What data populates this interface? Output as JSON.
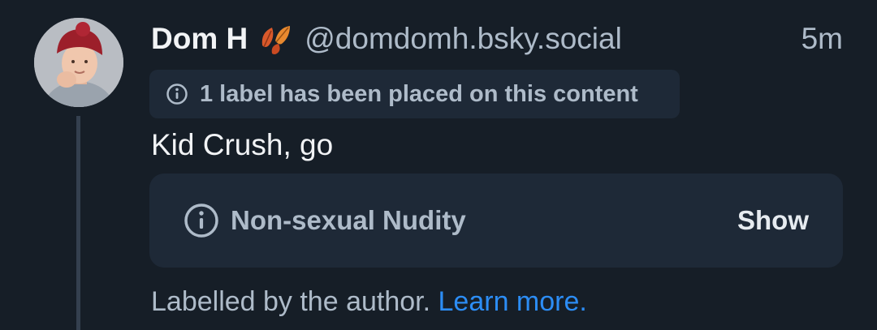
{
  "post": {
    "display_name": "Dom H",
    "handle": "@domdomh.bsky.social",
    "timestamp": "5m",
    "label_notice": "1 label has been placed on this content",
    "text": "Kid Crush, go",
    "content_warning": {
      "label": "Non-sexual Nudity",
      "show_button": "Show"
    },
    "footer": {
      "prefix": "Labelled by the author.",
      "link": "Learn more."
    }
  },
  "icons": {
    "name_emoji": "falling-leaves-icon",
    "label_notice": "info-icon",
    "content_warning": "info-icon"
  },
  "colors": {
    "background": "#161e27",
    "card": "#1e2937",
    "primary_text": "#f1f3f5",
    "secondary_text": "#aebbc9",
    "link": "#2c8df5",
    "thread_line": "#34404f"
  }
}
